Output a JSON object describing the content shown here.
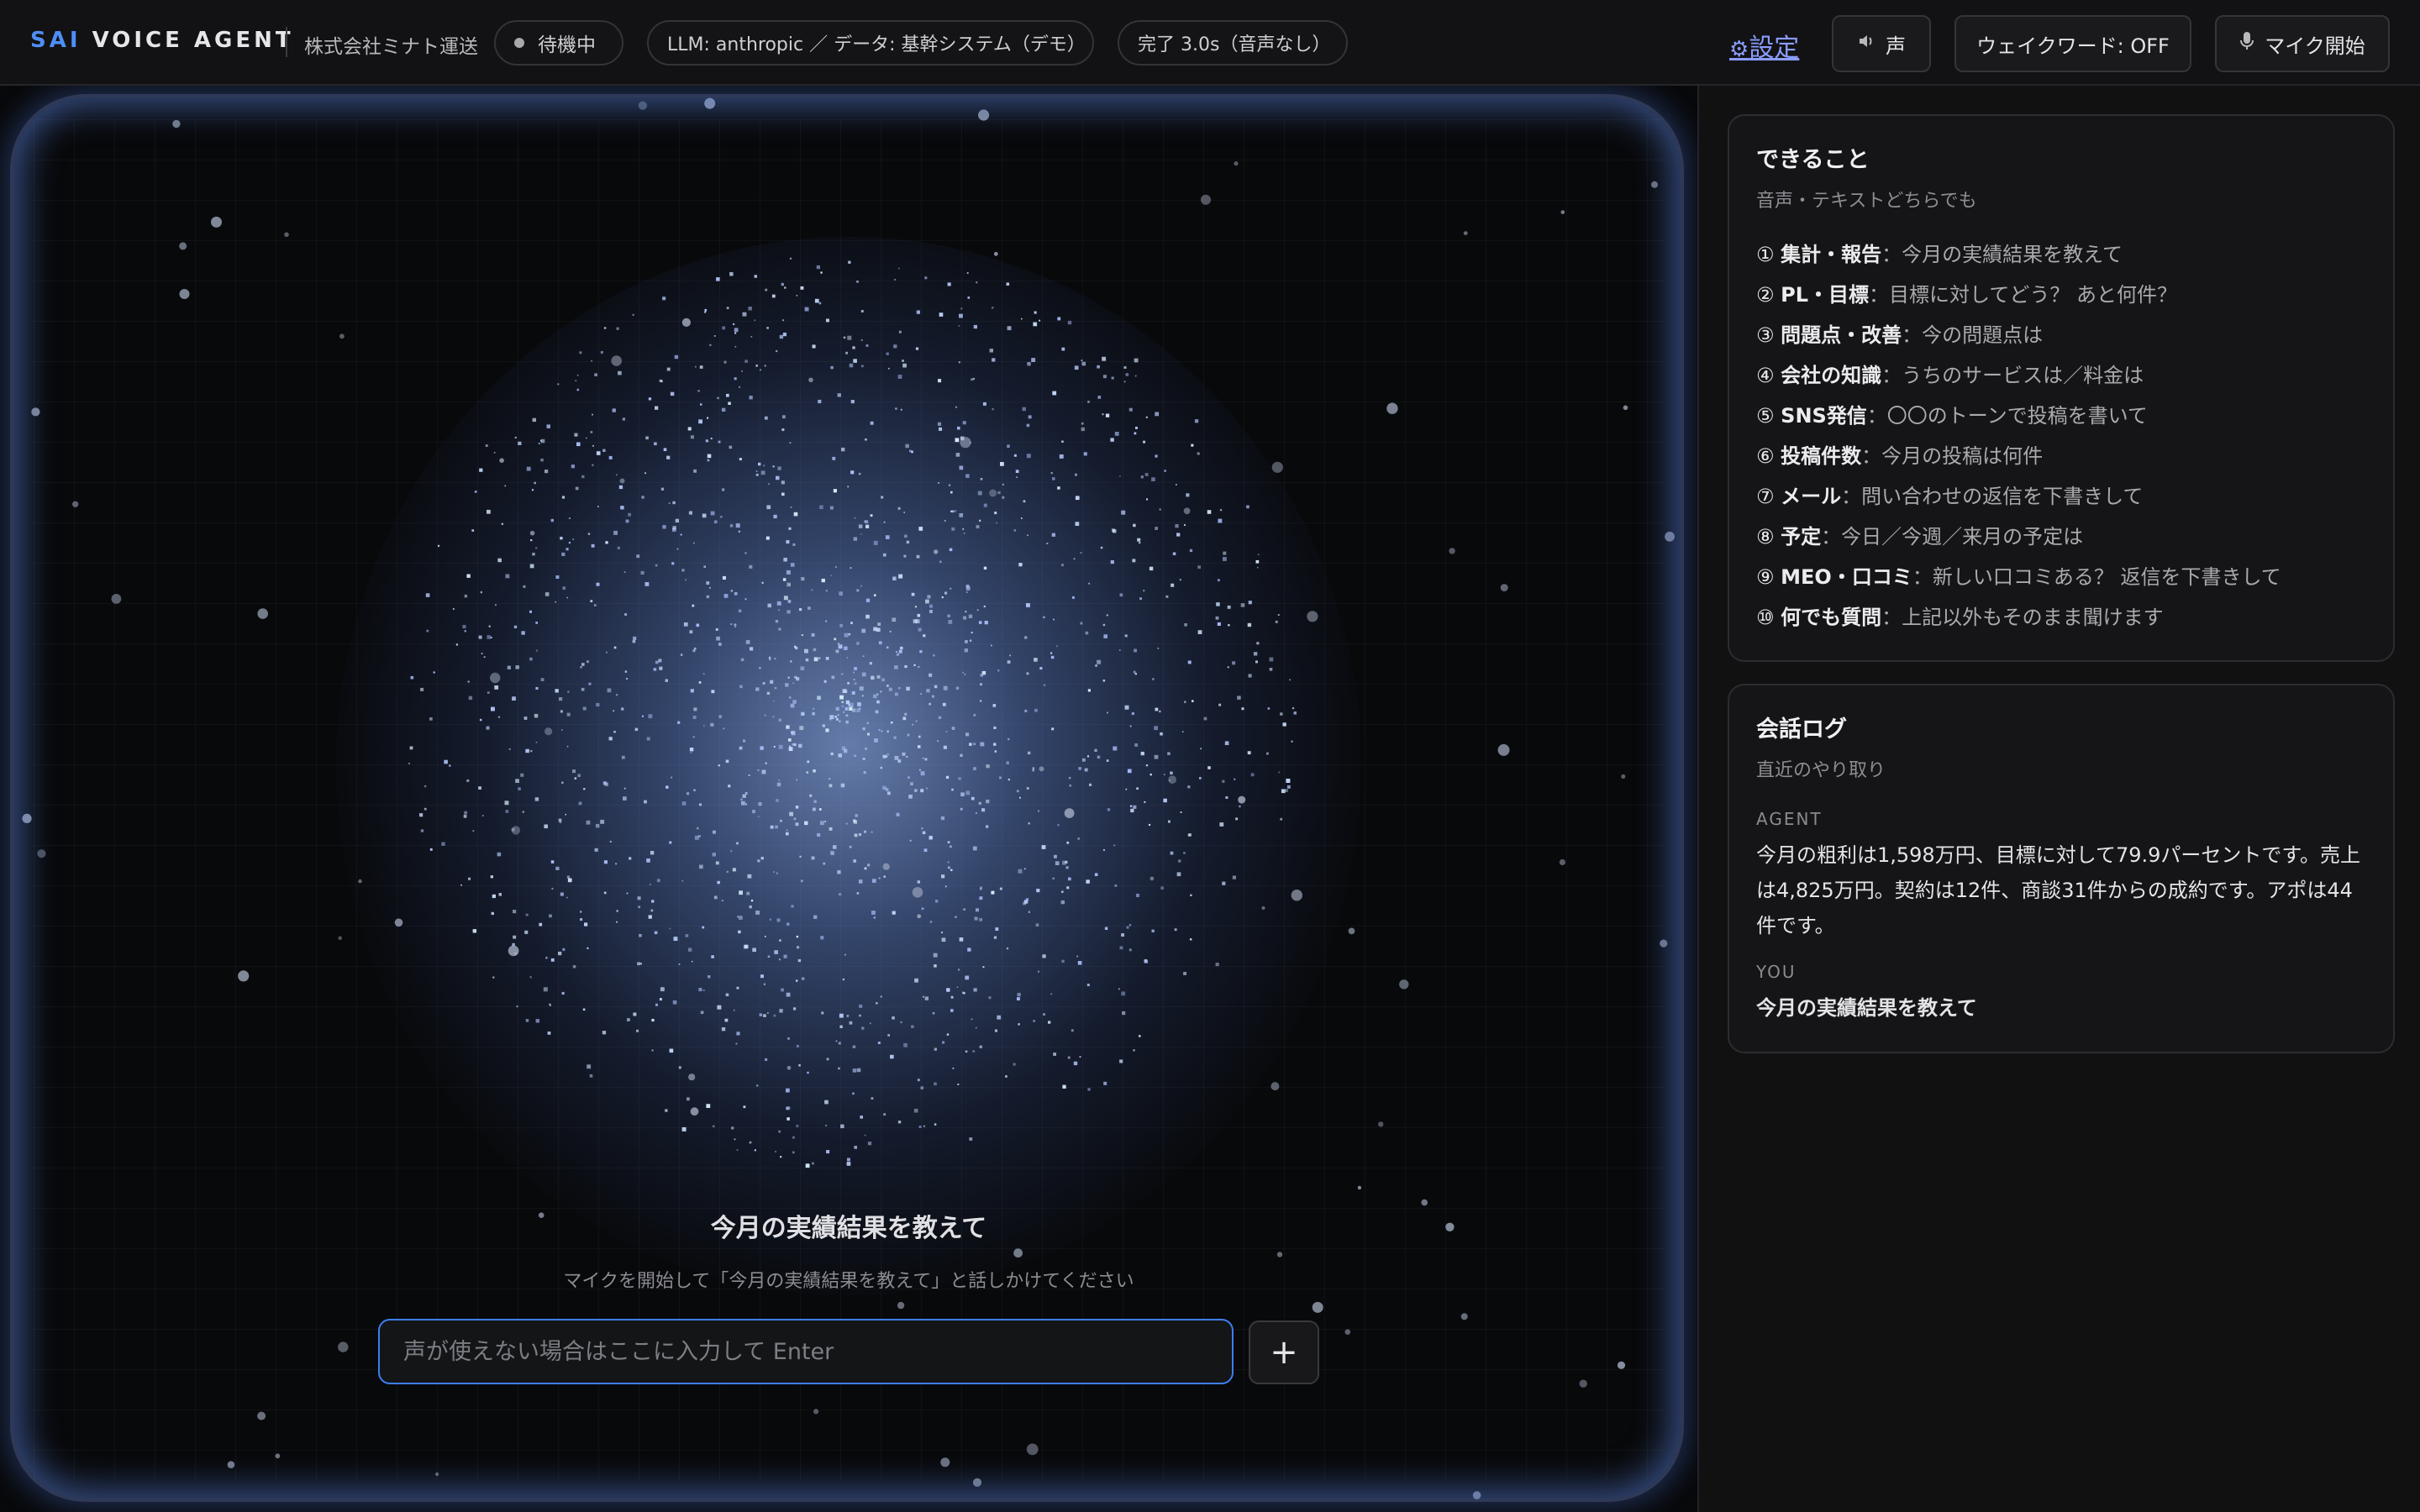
{
  "header": {
    "brand_accent": "SAI",
    "brand_rest": " VOICE AGENT",
    "company": "株式会社ミナト運送",
    "status": "待機中",
    "llm_info": "LLM: anthropic ／ データ: 基幹システム（デモ）",
    "timing": "完了 3.0s（音声なし）",
    "settings_icon": "gear-icon",
    "settings_label": "設定",
    "voice_icon": "speaker-icon",
    "voice_label": "声",
    "wakeword_label": "ウェイクワード: OFF",
    "mic_icon": "microphone-icon",
    "mic_label": "マイク開始"
  },
  "stage": {
    "caption": "今月の実績結果を教えて",
    "hint": "マイクを開始して「今月の実績結果を教えて」と話しかけてください",
    "input_placeholder": "声が使えない場合はここに入力して Enter",
    "input_value": "",
    "add_label": "+"
  },
  "capabilities": {
    "title": "できること",
    "subtitle": "音声・テキストどちらでも",
    "items": [
      {
        "num": "①",
        "key": "集計・報告",
        "desc": "：今月の実績結果を教えて"
      },
      {
        "num": "②",
        "key": "PL・目標",
        "desc": "：目標に対してどう？ あと何件？"
      },
      {
        "num": "③",
        "key": "問題点・改善",
        "desc": "：今の問題点は"
      },
      {
        "num": "④",
        "key": "会社の知識",
        "desc": "：うちのサービスは／料金は"
      },
      {
        "num": "⑤",
        "key": "SNS発信",
        "desc": "：〇〇のトーンで投稿を書いて"
      },
      {
        "num": "⑥",
        "key": "投稿件数",
        "desc": "：今月の投稿は何件"
      },
      {
        "num": "⑦",
        "key": "メール",
        "desc": "：問い合わせの返信を下書きして"
      },
      {
        "num": "⑧",
        "key": "予定",
        "desc": "：今日／今週／来月の予定は"
      },
      {
        "num": "⑨",
        "key": "MEO・口コミ",
        "desc": "：新しい口コミある？ 返信を下書きして"
      },
      {
        "num": "⑩",
        "key": "何でも質問",
        "desc": "：上記以外もそのまま聞けます"
      }
    ]
  },
  "log": {
    "title": "会話ログ",
    "subtitle": "直近のやり取り",
    "entries": [
      {
        "role": "AGENT",
        "text": "今月の粗利は1,598万円、目標に対して79.9パーセントです。売上は4,825万円。契約は12件、商談31件からの成約です。アポは44件です。"
      },
      {
        "role": "YOU",
        "text": "今月の実績結果を教えて"
      }
    ]
  },
  "colors": {
    "accent": "#4f8ef7",
    "link": "#8a9cff",
    "input_border": "#3d7ef0",
    "glow": "#8fb4ff"
  }
}
